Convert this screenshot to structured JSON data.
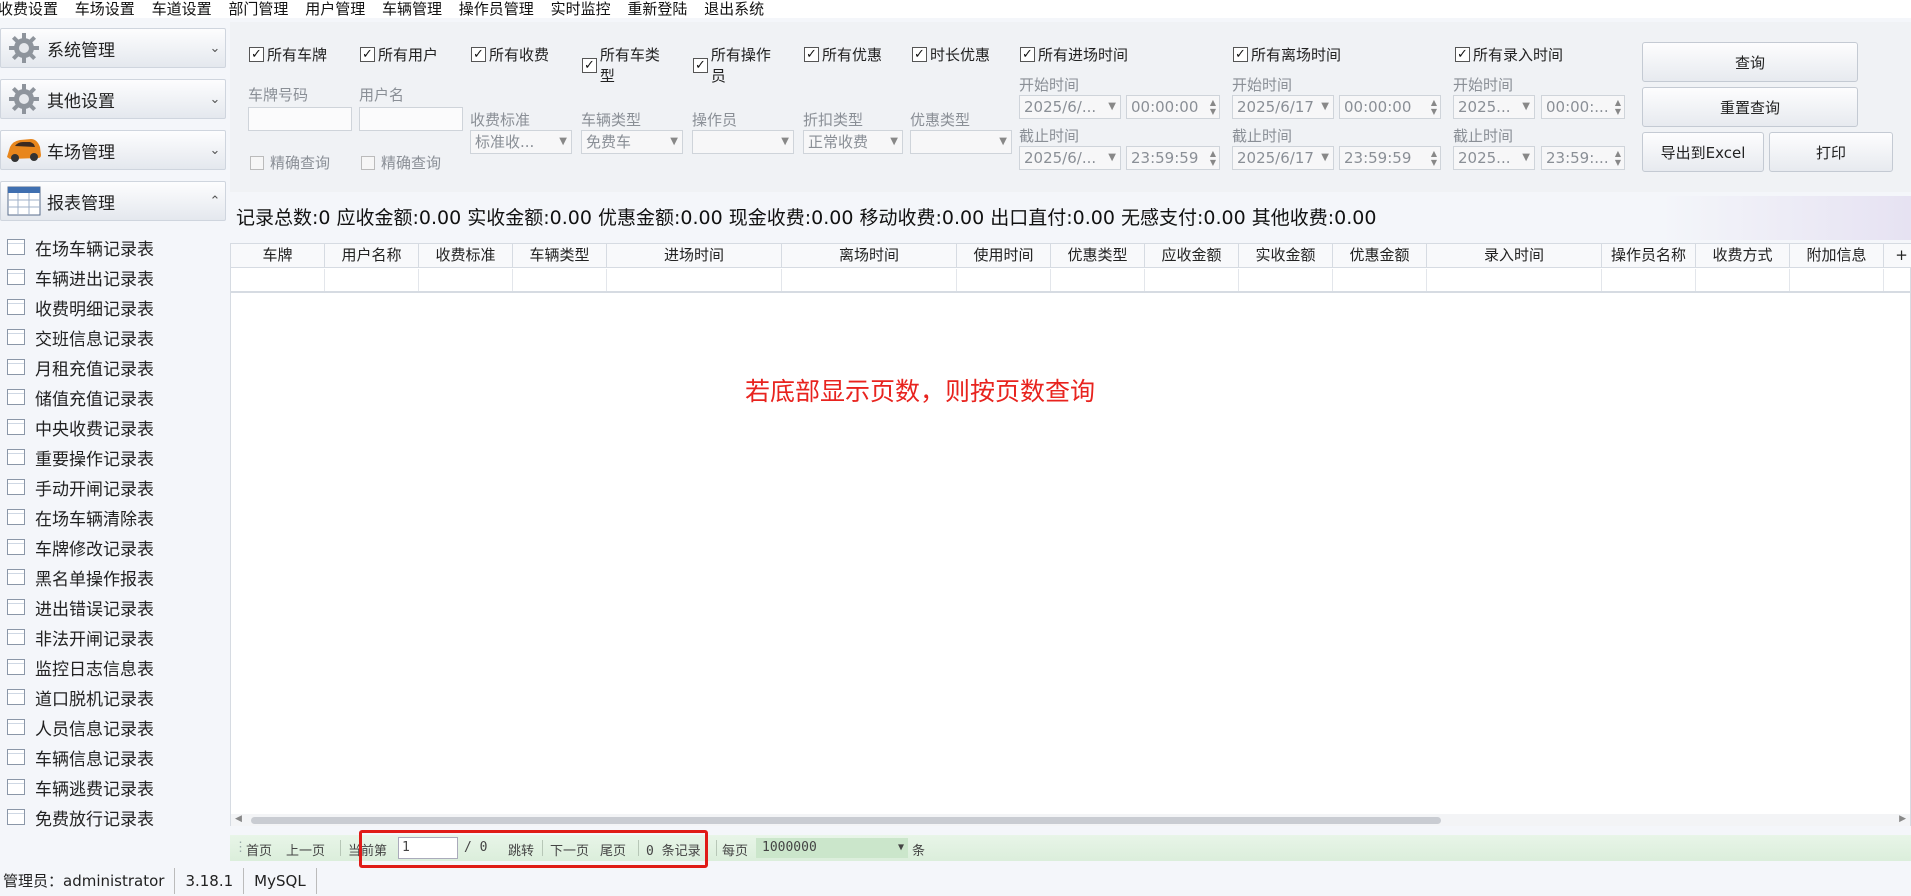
{
  "menubar": {
    "items": [
      "收费设置",
      "车场设置",
      "车道设置",
      "部门管理",
      "用户管理",
      "车辆管理",
      "操作员管理",
      "实时监控",
      "重新登陆",
      "退出系统"
    ]
  },
  "sidebar": {
    "groups": [
      {
        "label": "系统管理",
        "icon": "gear-icon",
        "chev": "⌄"
      },
      {
        "label": "其他设置",
        "icon": "gear-icon",
        "chev": "⌄"
      },
      {
        "label": "车场管理",
        "icon": "car-icon",
        "chev": "⌄"
      },
      {
        "label": "报表管理",
        "icon": "calendar-icon",
        "chev": "⌃"
      }
    ],
    "items": [
      "在场车辆记录表",
      "车辆进出记录表",
      "收费明细记录表",
      "交班信息记录表",
      "月租充值记录表",
      "储值充值记录表",
      "中央收费记录表",
      "重要操作记录表",
      "手动开闸记录表",
      "在场车辆清除表",
      "车牌修改记录表",
      "黑名单操作报表",
      "进出错误记录表",
      "非法开闸记录表",
      "监控日志信息表",
      "道口脱机记录表",
      "人员信息记录表",
      "车辆信息记录表",
      "车辆逃费记录表",
      "免费放行记录表"
    ]
  },
  "filter": {
    "plate": {
      "chk": "所有车牌",
      "label": "车牌号码",
      "exact": "精确查询"
    },
    "user": {
      "chk": "所有用户",
      "label": "用户名",
      "exact": "精确查询"
    },
    "fee": {
      "chk": "所有收费",
      "label": "收费标准",
      "value": "标准收..."
    },
    "cartype": {
      "chk": "所有车类型",
      "label": "车辆类型",
      "value": "免费车"
    },
    "operator": {
      "chk": "所有操作员",
      "label": "操作员",
      "value": ""
    },
    "discount": {
      "chk": "所有优惠",
      "label": "折扣类型",
      "value": "正常收费"
    },
    "timedisc": {
      "chk": "时长优惠",
      "label": "优惠类型",
      "value": ""
    },
    "entry": {
      "chk": "所有进场时间",
      "start_label": "开始时间",
      "start_date": "2025/6/...",
      "start_time": "00:00:00",
      "end_label": "截止时间",
      "end_date": "2025/6/...",
      "end_time": "23:59:59"
    },
    "exit": {
      "chk": "所有离场时间",
      "start_label": "开始时间",
      "start_date": "2025/6/17",
      "start_time": "00:00:00",
      "end_label": "截止时间",
      "end_date": "2025/6/17",
      "end_time": "23:59:59"
    },
    "record": {
      "chk": "所有录入时间",
      "start_label": "开始时间",
      "start_date": "2025...",
      "start_time": "00:00:...",
      "end_label": "截止时间",
      "end_date": "2025...",
      "end_time": "23:59:..."
    },
    "check_mark": "✓",
    "buttons": {
      "query": "查询",
      "reset": "重置查询",
      "export": "导出到Excel",
      "print": "打印"
    }
  },
  "summary": "记录总数:0  应收金额:0.00  实收金额:0.00  优惠金额:0.00  现金收费:0.00  移动收费:0.00  出口直付:0.00  无感支付:0.00  其他收费:0.00",
  "grid": {
    "columns": [
      "车牌",
      "用户名称",
      "收费标准",
      "车辆类型",
      "进场时间",
      "离场时间",
      "使用时间",
      "优惠类型",
      "应收金额",
      "实收金额",
      "优惠金额",
      "录入时间",
      "操作员名称",
      "收费方式",
      "附加信息",
      "+"
    ],
    "note": "若底部显示页数，则按页数查询"
  },
  "pager": {
    "first": "首页",
    "prev": "上一页",
    "current_label": "当前第",
    "current_value": "1",
    "total": "/ 0",
    "jump": "跳转",
    "next": "下一页",
    "last": "尾页",
    "records": "0 条记录",
    "per_page_label": "每页",
    "per_page_value": "1000000",
    "unit": "条"
  },
  "status": {
    "admin": "管理员：administrator",
    "version": "3.18.1",
    "db": "MySQL"
  },
  "colors": {
    "note": "#e8231e",
    "highlight": "#e01b17",
    "pager_bg": "#dbeedb"
  }
}
